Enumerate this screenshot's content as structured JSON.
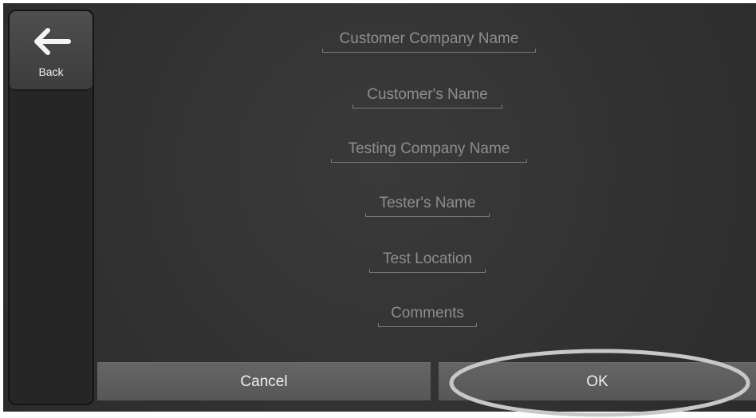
{
  "sidebar": {
    "back_label": "Back",
    "back_icon": "arrow-left-icon"
  },
  "fields": [
    {
      "placeholder": "Customer Company Name"
    },
    {
      "placeholder": "Customer's Name"
    },
    {
      "placeholder": "Testing Company Name"
    },
    {
      "placeholder": "Tester's Name"
    },
    {
      "placeholder": "Test Location"
    },
    {
      "placeholder": "Comments"
    }
  ],
  "actions": {
    "cancel_label": "Cancel",
    "ok_label": "OK"
  },
  "colors": {
    "background": "#333333",
    "button": "#5e5e5e",
    "placeholder_text": "#8e8e8e",
    "highlight_outline": "#c8c8c8"
  }
}
